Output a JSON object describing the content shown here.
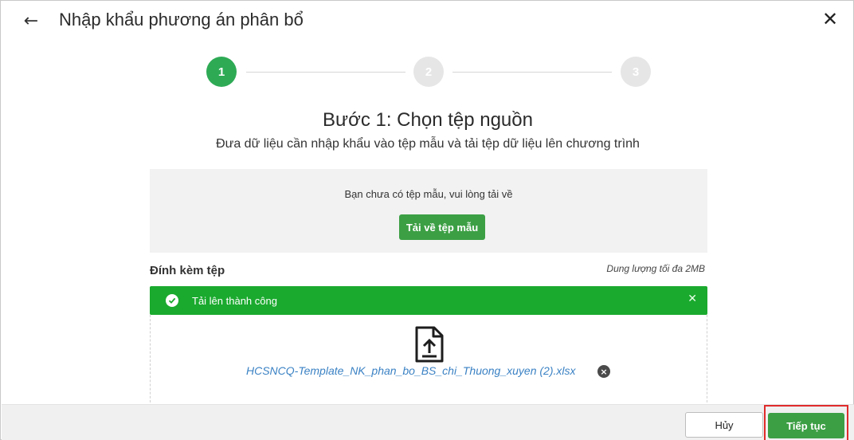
{
  "header": {
    "back_icon": "arrow-left-icon",
    "title": "Nhập khẩu phương án phân bổ",
    "close_icon": "close-icon"
  },
  "stepper": {
    "steps": [
      {
        "label": "1",
        "state": "active"
      },
      {
        "label": "2",
        "state": "inactive"
      },
      {
        "label": "3",
        "state": "inactive"
      }
    ],
    "active_color": "#2eaa55"
  },
  "step": {
    "title": "Bước 1: Chọn tệp nguồn",
    "description": "Đưa dữ liệu cần nhập khẩu vào tệp mẫu và tải tệp dữ liệu lên chương trình"
  },
  "template": {
    "message": "Bạn chưa có tệp mẫu, vui lòng tải về",
    "download_label": "Tải về tệp mẫu"
  },
  "attachment": {
    "label": "Đính kèm tệp",
    "size_note": "Dung lượng tối đa 2MB",
    "success_message": "Tải lên thành công",
    "success_color": "#1aaa2e",
    "file_icon": "file-upload-icon",
    "file_name": "HCSNCQ-Template_NK_phan_bo_BS_chi_Thuong_xuyen (2).xlsx"
  },
  "footer": {
    "cancel_label": "Hủy",
    "continue_label": "Tiếp tục",
    "highlight_color": "#e02b2b"
  }
}
